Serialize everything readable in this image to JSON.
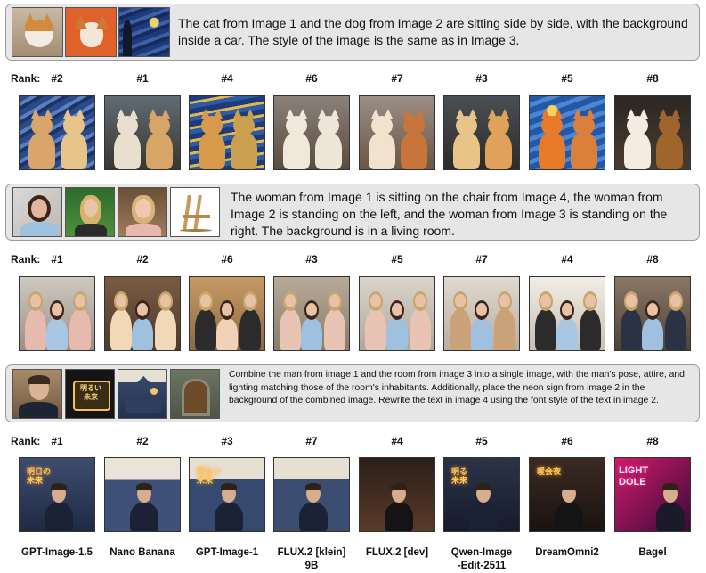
{
  "rank_label": "Rank:",
  "prompts": [
    "The cat from Image 1 and the dog from Image 2 are sitting side by side, with the background inside a car. The style of the image is the same as in Image 3.",
    "The woman from Image 1 is sitting on the chair from Image 4, the woman from Image 2 is standing on the left, and the woman from Image 3 is standing on the right. The background is in a living room.",
    "Combine the man from image 1 and the room from image 3 into a single image, with the man's pose, attire, and lighting matching those of the room's inhabitants. Additionally, place the neon sign from image 2 in the background of the combined image. Rewrite the text in image 4 using the font style of the text in image 2."
  ],
  "ranks": [
    [
      "#2",
      "#1",
      "#4",
      "#6",
      "#7",
      "#3",
      "#5",
      "#8"
    ],
    [
      "#1",
      "#2",
      "#6",
      "#3",
      "#5",
      "#7",
      "#4",
      "#8"
    ],
    [
      "#1",
      "#2",
      "#3",
      "#7",
      "#4",
      "#5",
      "#6",
      "#8"
    ]
  ],
  "models": [
    [
      "GPT-Image-1.5"
    ],
    [
      "Nano Banana"
    ],
    [
      "GPT-Image-1"
    ],
    [
      "FLUX.2 [klein]",
      "9B"
    ],
    [
      "FLUX.2 [dev]"
    ],
    [
      "Qwen-Image",
      "-Edit-2511"
    ],
    [
      "DreamOmni2"
    ],
    [
      "Bagel"
    ]
  ],
  "neon_text": {
    "ref": "明るい\n未来",
    "gen1": "明日の\n未来",
    "gen3": "明るい\n未来",
    "gen5": "明る\n未来",
    "gen7": "暖会夜",
    "bagel": "LIGHT\nDOLE"
  }
}
